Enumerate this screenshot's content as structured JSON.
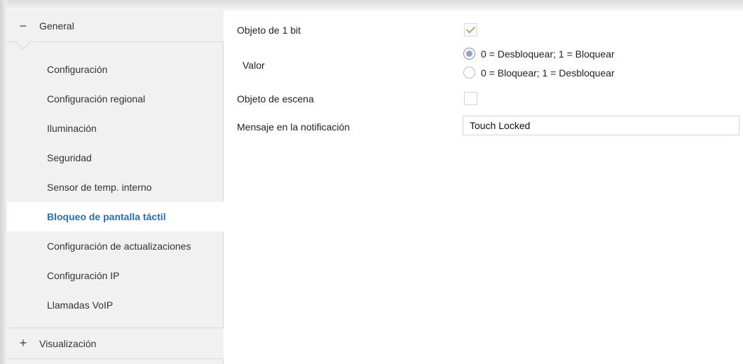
{
  "sidebar": {
    "groups": [
      {
        "sign": "−",
        "label": "General",
        "expanded": true
      },
      {
        "sign": "+",
        "label": "Visualización",
        "expanded": false
      }
    ],
    "items": [
      {
        "label": "Configuración"
      },
      {
        "label": "Configuración regional"
      },
      {
        "label": "Iluminación"
      },
      {
        "label": "Seguridad"
      },
      {
        "label": "Sensor de temp. interno"
      },
      {
        "label": "Bloqueo de pantalla táctil",
        "active": true
      },
      {
        "label": "Configuración de actualizaciones"
      },
      {
        "label": "Configuración IP"
      },
      {
        "label": "Llamadas VoIP"
      }
    ]
  },
  "main": {
    "object_1bit": {
      "label": "Objeto de 1 bit",
      "checked": true
    },
    "value": {
      "label": "Valor",
      "options": [
        {
          "label": "0 = Desbloquear; 1 = Bloquear",
          "selected": true
        },
        {
          "label": "0 = Bloquear; 1 = Desbloquear",
          "selected": false
        }
      ]
    },
    "scene_object": {
      "label": "Objeto de escena",
      "checked": false
    },
    "notification": {
      "label": "Mensaje en la notificación",
      "value": "Touch Locked"
    }
  },
  "colors": {
    "active_item": "#2a6fb5",
    "sidebar_bg": "#f1f1f1",
    "check_tick": "#8fbf6a",
    "radio_selected": "#8ea6c4"
  }
}
